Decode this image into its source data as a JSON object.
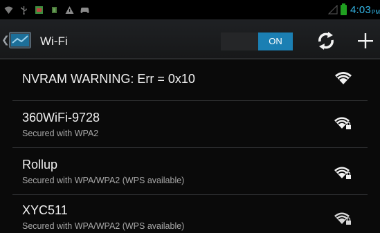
{
  "status_bar": {
    "icons": [
      "wifi-status-icon",
      "usb-icon",
      "app-notification-icon",
      "android-icon",
      "warning-icon",
      "game-controller-icon"
    ],
    "time": "4:03",
    "time_suffix": "PM",
    "clock_color": "#33b5e5"
  },
  "action_bar": {
    "title": "Wi-Fi",
    "toggle_on_label": "ON",
    "toggle_color": "#1b7fb3"
  },
  "networks": [
    {
      "name": "NVRAM WARNING: Err = 0x10",
      "security": "",
      "secured": false
    },
    {
      "name": "360WiFi-9728",
      "security": "Secured with WPA2",
      "secured": true
    },
    {
      "name": "Rollup",
      "security": "Secured with WPA/WPA2 (WPS available)",
      "secured": true
    },
    {
      "name": "XYC511",
      "security": "Secured with WPA/WPA2 (WPS available)",
      "secured": true
    }
  ]
}
